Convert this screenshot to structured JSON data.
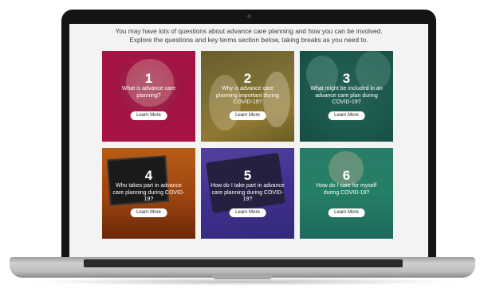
{
  "intro": {
    "line1": "You may have lots of questions about advance care planning and how you can be involved.",
    "line2": "Explore the questions and key terms section below, taking breaks as you need to."
  },
  "cards": [
    {
      "number": "1",
      "question": "What is advance care planning?",
      "button": "Learn More"
    },
    {
      "number": "2",
      "question": "Why is advance care planning important during COVID-19?",
      "button": "Learn More"
    },
    {
      "number": "3",
      "question": "What might be included in an advance care plan during COVID-19?",
      "button": "Learn More"
    },
    {
      "number": "4",
      "question": "Who takes part in advance care planning during COVID-19?",
      "button": "Learn More"
    },
    {
      "number": "5",
      "question": "How do I take part in advance care planning during COVID-19?",
      "button": "Learn More"
    },
    {
      "number": "6",
      "question": "How do I care for myself during COVID-19?",
      "button": "Learn More"
    }
  ],
  "colors": {
    "card1": "#c2134f",
    "card2": "#8d7f3d",
    "card3": "#1f6457",
    "card4": "#b34d12",
    "card5": "#4638a4",
    "card6": "#2a9074"
  }
}
